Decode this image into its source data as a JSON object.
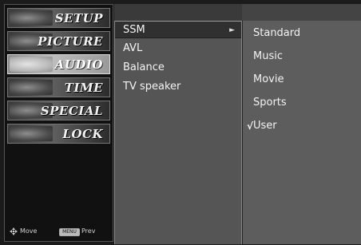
{
  "categories": [
    {
      "label": "SETUP",
      "active": false
    },
    {
      "label": "PICTURE",
      "active": false
    },
    {
      "label": "AUDIO",
      "active": true
    },
    {
      "label": "TIME",
      "active": false
    },
    {
      "label": "SPECIAL",
      "active": false
    },
    {
      "label": "LOCK",
      "active": false
    }
  ],
  "footer": {
    "move_label": "Move",
    "menu_key": "MENU",
    "prev_label": "Prev"
  },
  "submenu": {
    "items": [
      "SSM",
      "AVL",
      "Balance",
      "TV speaker"
    ],
    "selected": "SSM",
    "arrow": "►"
  },
  "options": {
    "items": [
      "Standard",
      "Music",
      "Movie",
      "Sports",
      "User"
    ],
    "checked": "User",
    "check_mark": "√"
  }
}
